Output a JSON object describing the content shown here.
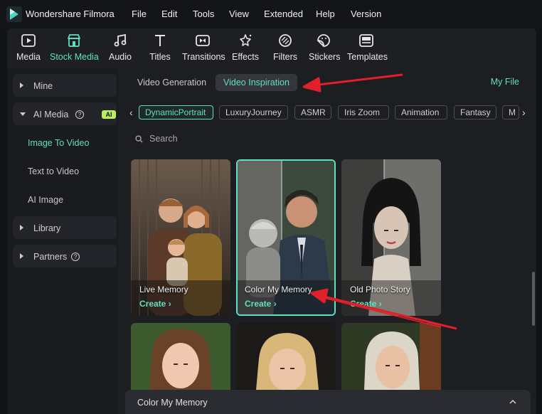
{
  "app": {
    "title": "Wondershare Filmora",
    "menu": [
      "File",
      "Edit",
      "Tools",
      "View",
      "Extended",
      "Help",
      "Version"
    ]
  },
  "toolbar": {
    "items": [
      {
        "label": "Media",
        "icon": "media-icon"
      },
      {
        "label": "Stock Media",
        "icon": "stock-media-icon",
        "active": true
      },
      {
        "label": "Audio",
        "icon": "audio-icon"
      },
      {
        "label": "Titles",
        "icon": "titles-icon"
      },
      {
        "label": "Transitions",
        "icon": "transitions-icon"
      },
      {
        "label": "Effects",
        "icon": "effects-icon"
      },
      {
        "label": "Filters",
        "icon": "filters-icon"
      },
      {
        "label": "Stickers",
        "icon": "stickers-icon"
      },
      {
        "label": "Templates",
        "icon": "templates-icon"
      }
    ]
  },
  "sidebar": {
    "mine": "Mine",
    "ai_media": "AI Media",
    "ai_badge": "AI",
    "help_glyph": "?",
    "sub_items": [
      "Image To Video",
      "Text to Video",
      "AI Image"
    ],
    "active_sub": "Image To Video",
    "library": "Library",
    "partners": "Partners"
  },
  "main": {
    "tabs": [
      "Video Generation",
      "Video Inspiration"
    ],
    "active_tab": "Video Inspiration",
    "my_file": "My File",
    "chips": [
      "DynamicPortrait",
      "LuxuryJourney",
      "ASMR",
      "Iris Zoom",
      "Animation",
      "Fantasy",
      "M"
    ],
    "active_chip": "DynamicPortrait",
    "search_placeholder": "Search",
    "cards": [
      {
        "title": "Live Memory",
        "cta": "Create ›"
      },
      {
        "title": "Color My Memory",
        "cta": "Create ›",
        "selected": true
      },
      {
        "title": "Old Photo Story",
        "cta": "Create ›"
      }
    ],
    "bottom_panel_title": "Color My Memory"
  },
  "colors": {
    "accent": "#5fe0c0",
    "annotation_arrow": "#e0202a",
    "ai_badge": "#b8f05a"
  }
}
